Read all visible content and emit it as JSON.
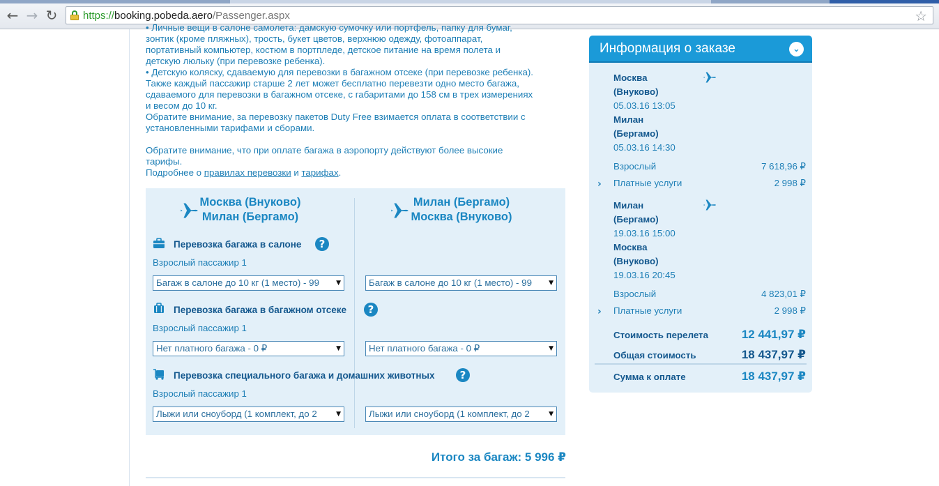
{
  "browser": {
    "url_scheme": "https://",
    "url_host": "booking.pobeda.aero",
    "url_path": "/Passenger.aspx",
    "back_icon": "←",
    "forward_icon": "→",
    "reload_icon": "↻",
    "star_icon": "☆"
  },
  "info": {
    "lines": [
      "• Личные вещи в салоне самолета: дамскую сумочку или портфель, папку для бумаг,",
      "зонтик (кроме пляжных), трость, букет цветов, верхнюю одежду, фотоаппарат,",
      "портативный компьютер, костюм в портпледе, детское питание на время полета и",
      "детскую люльку (при перевозке ребенка).",
      "• Детскую коляску, сдаваемую для перевозки в багажном отсеке (при перевозке ребенка).",
      "Также каждый пассажир старше 2 лет может бесплатно перевезти одно место багажа,",
      "сдаваемого для перевозки в багажном отсеке, с габаритами до 158 см в трех измерениях",
      "и весом до 10 кг.",
      "Обратите внимание, за перевозку пакетов Duty Free взимается оплата в соответствии с",
      "установленными тарифами и сборами."
    ],
    "notice_line1": "Обратите внимание, что при оплате багажа в аэропорту действуют более высокие",
    "notice_line2": "тарифы.",
    "more_prefix": "Подробнее о ",
    "rules_link": "правилах перевозки",
    "and": " и ",
    "tariffs_link": "тарифах",
    "period": "."
  },
  "routes": [
    {
      "from": "Москва (Внуково)",
      "to": "Милан (Бергамо)"
    },
    {
      "from": "Милан (Бергамо)",
      "to": "Москва (Внуково)"
    }
  ],
  "categories": {
    "cabin": {
      "title": "Перевозка багажа в салоне",
      "passenger": "Взрослый пассажир 1",
      "selected": [
        "Багаж в салоне до 10 кг (1 место) - 99",
        "Багаж в салоне до 10 кг (1 место) - 99"
      ]
    },
    "hold": {
      "title": "Перевозка багажа в багажном отсеке",
      "passenger": "Взрослый пассажир 1",
      "selected": [
        "Нет платного багажа - 0 ₽",
        "Нет платного багажа - 0 ₽"
      ]
    },
    "special": {
      "title": "Перевозка специального багажа и домашних животных",
      "passenger": "Взрослый пассажир 1",
      "selected": [
        "Лыжи или сноуборд (1 комплект, до 2",
        "Лыжи или сноуборд (1 комплект, до 2"
      ]
    },
    "help_label": "?",
    "dropdown_arrow": "▼"
  },
  "baggage_total": "Итого за багаж: 5 996 ₽",
  "order": {
    "title": "Информация о заказе",
    "toggle": "⌄",
    "segments": [
      {
        "from_city": "Москва",
        "from_airport": "(Внуково)",
        "depart": "05.03.16 13:05",
        "to_city": "Милан",
        "to_airport": "(Бергамо)",
        "arrive": "05.03.16 14:30",
        "adult_label": "Взрослый",
        "adult_price": "7 618,96 ₽",
        "services_label": "Платные услуги",
        "services_price": "2 998 ₽"
      },
      {
        "from_city": "Милан",
        "from_airport": "(Бергамо)",
        "depart": "19.03.16 15:00",
        "to_city": "Москва",
        "to_airport": "(Внуково)",
        "arrive": "19.03.16 20:45",
        "adult_label": "Взрослый",
        "adult_price": "4 823,01 ₽",
        "services_label": "Платные услуги",
        "services_price": "2 998 ₽"
      }
    ],
    "flight_cost_label": "Стоимость перелета",
    "flight_cost": "12 441,97 ₽",
    "total_label": "Общая стоимость",
    "total": "18 437,97 ₽",
    "pay_label": "Сумма к оплате",
    "pay": "18 437,97 ₽",
    "chevron": "›"
  }
}
